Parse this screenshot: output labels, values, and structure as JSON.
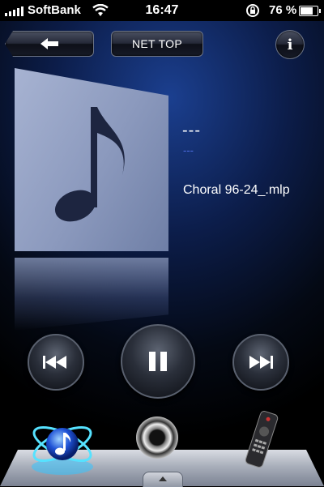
{
  "status_bar": {
    "carrier": "SoftBank",
    "time": "16:47",
    "battery_percent": "76 %",
    "signal_bars": 5,
    "battery_level": 0.76
  },
  "header": {
    "back_icon": "arrow-left-icon",
    "nettop_label": "NET TOP",
    "info_label": "i"
  },
  "now_playing": {
    "track_title": "---",
    "artist": "---",
    "file_name": "Choral 96-24_.mlp",
    "artwork_icon": "music-note-icon"
  },
  "transport": {
    "previous_icon": "skip-previous-icon",
    "pause_icon": "pause-icon",
    "next_icon": "skip-next-icon"
  },
  "dock": {
    "tabs": [
      {
        "icon": "music-source-icon",
        "selected": true
      },
      {
        "icon": "speaker-icon",
        "selected": false
      },
      {
        "icon": "remote-control-icon",
        "selected": false
      }
    ],
    "expand_icon": "chevron-up-icon"
  },
  "colors": {
    "accent_blue": "#4f6fe6",
    "background_glow": "#1b3f8f"
  }
}
